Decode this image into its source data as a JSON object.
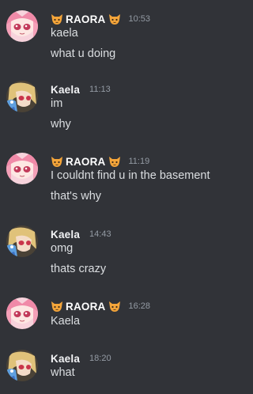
{
  "colors": {
    "background": "#313338",
    "message_text": "#dbdee1",
    "timestamp": "#949ba4",
    "username": "#f2f3f5"
  },
  "messages": [
    {
      "author": "RAORA",
      "avatar": "raora-avatar",
      "emoji_left": "cat-face-emoji",
      "emoji_right": "cat-face-emoji",
      "timestamp": "10:53",
      "lines": [
        "kaela",
        "what  u doing"
      ]
    },
    {
      "author": "Kaela",
      "avatar": "kaela-avatar",
      "timestamp": "11:13",
      "lines": [
        "im",
        "why"
      ]
    },
    {
      "author": "RAORA",
      "avatar": "raora-avatar",
      "emoji_left": "cat-face-emoji",
      "emoji_right": "cat-face-emoji",
      "timestamp": "11:19",
      "lines": [
        "I couldnt find  u in the basement",
        "that's why"
      ]
    },
    {
      "author": "Kaela",
      "avatar": "kaela-avatar",
      "timestamp": "14:43",
      "lines": [
        "omg",
        "thats crazy"
      ]
    },
    {
      "author": "RAORA",
      "avatar": "raora-avatar",
      "emoji_left": "cat-face-emoji",
      "emoji_right": "cat-face-emoji",
      "timestamp": "16:28",
      "lines": [
        "Kaela"
      ]
    },
    {
      "author": "Kaela",
      "avatar": "kaela-avatar",
      "timestamp": "18:20",
      "lines": [
        "what"
      ]
    }
  ]
}
